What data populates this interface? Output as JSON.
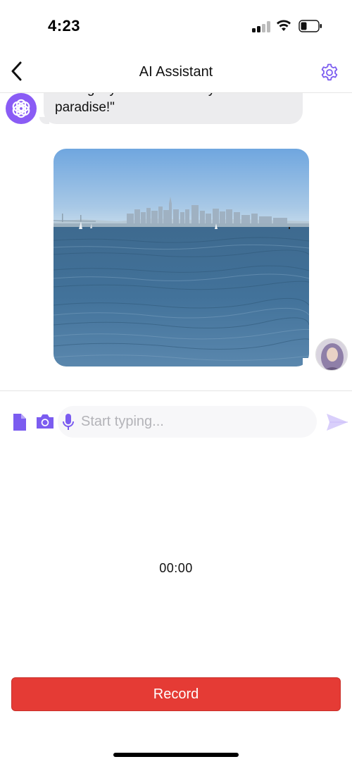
{
  "status_bar": {
    "time": "4:23"
  },
  "nav": {
    "title": "AI Assistant",
    "back_icon": "chevron-left-icon",
    "settings_icon": "gear-icon"
  },
  "chat": {
    "bot_message": "\"Living my best life with my little one in paradise!\"",
    "photo_description_icon": "photo-message"
  },
  "composer": {
    "placeholder": "Start typing...",
    "icons": [
      "document-icon",
      "camera-icon",
      "microphone-icon",
      "send-icon"
    ]
  },
  "recorder": {
    "timer": "00:00",
    "record_label": "Record"
  },
  "colors": {
    "accent": "#7b5cf0",
    "record": "#e53b35",
    "bubble": "#ececee"
  }
}
